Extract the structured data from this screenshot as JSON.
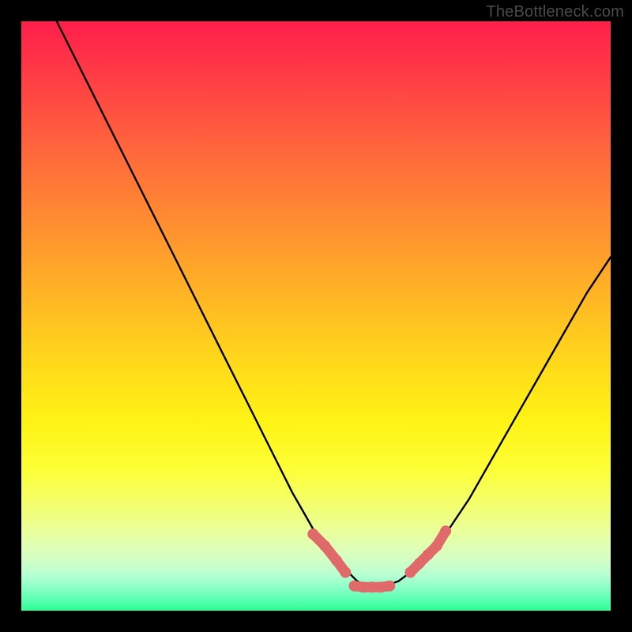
{
  "watermark": "TheBottleneck.com",
  "chart_data": {
    "type": "line",
    "title": "",
    "xlabel": "",
    "ylabel": "",
    "xlim": [
      0,
      100
    ],
    "ylim": [
      0,
      100
    ],
    "grid": false,
    "legend": false,
    "series": [
      {
        "name": "bottleneck-curve",
        "color": "#000000",
        "x": [
          6,
          10,
          14,
          18,
          22,
          26,
          30,
          34,
          38,
          42,
          46,
          50,
          54,
          57,
          59,
          61,
          64,
          68,
          72,
          76,
          80,
          84,
          88,
          92,
          96,
          100
        ],
        "y": [
          100,
          92,
          84,
          76,
          68,
          60,
          52,
          44,
          36,
          28,
          20,
          13,
          8,
          5,
          4,
          4,
          5,
          8,
          13,
          19,
          26,
          33,
          40,
          47,
          54,
          60
        ]
      },
      {
        "name": "highlight-dots-left",
        "color": "#e06a6a",
        "type": "scatter",
        "x": [
          49.5,
          51.5,
          53.5,
          55.0
        ],
        "y": [
          13.0,
          11.0,
          8.5,
          6.5
        ]
      },
      {
        "name": "highlight-bar-bottom",
        "color": "#e06a6a",
        "type": "scatter",
        "x": [
          56.5,
          58.0,
          59.5,
          61.0,
          62.5
        ],
        "y": [
          4.2,
          4.0,
          4.0,
          4.0,
          4.2
        ]
      },
      {
        "name": "highlight-dots-right",
        "color": "#e06a6a",
        "type": "scatter",
        "x": [
          66.0,
          67.5,
          69.0,
          70.5,
          72.0
        ],
        "y": [
          6.5,
          8.0,
          9.5,
          11.0,
          13.5
        ]
      }
    ]
  }
}
